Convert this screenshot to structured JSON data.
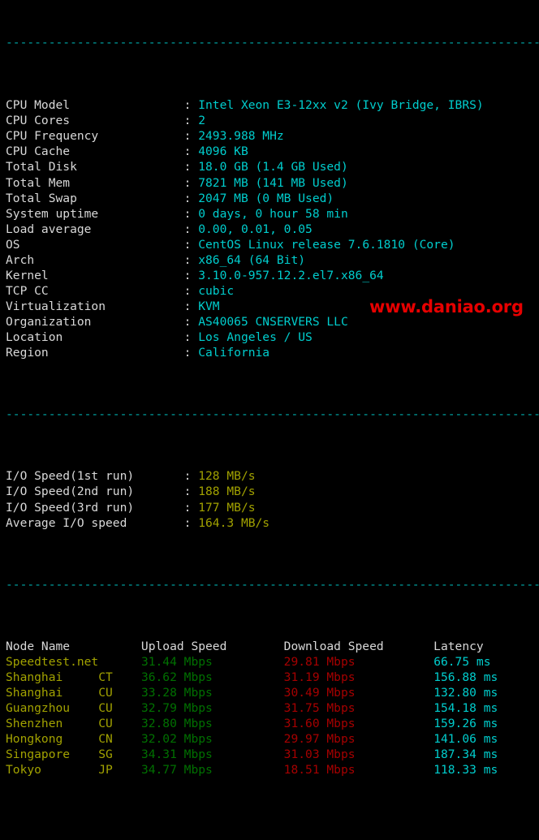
{
  "terminal": {
    "separator_char": "-",
    "separator_repeat": 78,
    "colon": ":",
    "label_width": 25,
    "sysinfo": [
      {
        "label": "CPU Model",
        "value": "Intel Xeon E3-12xx v2 (Ivy Bridge, IBRS)"
      },
      {
        "label": "CPU Cores",
        "value": "2"
      },
      {
        "label": "CPU Frequency",
        "value": "2493.988 MHz"
      },
      {
        "label": "CPU Cache",
        "value": "4096 KB"
      },
      {
        "label": "Total Disk",
        "value": "18.0 GB (1.4 GB Used)"
      },
      {
        "label": "Total Mem",
        "value": "7821 MB (141 MB Used)"
      },
      {
        "label": "Total Swap",
        "value": "2047 MB (0 MB Used)"
      },
      {
        "label": "System uptime",
        "value": "0 days, 0 hour 58 min"
      },
      {
        "label": "Load average",
        "value": "0.00, 0.01, 0.05"
      },
      {
        "label": "OS",
        "value": "CentOS Linux release 7.6.1810 (Core)"
      },
      {
        "label": "Arch",
        "value": "x86_64 (64 Bit)"
      },
      {
        "label": "Kernel",
        "value": "3.10.0-957.12.2.el7.x86_64"
      },
      {
        "label": "TCP CC",
        "value": "cubic"
      },
      {
        "label": "Virtualization",
        "value": "KVM"
      },
      {
        "label": "Organization",
        "value": "AS40065 CNSERVERS LLC"
      },
      {
        "label": "Location",
        "value": "Los Angeles / US"
      },
      {
        "label": "Region",
        "value": "California"
      }
    ],
    "iospeed": [
      {
        "label": "I/O Speed(1st run)",
        "value": "128 MB/s"
      },
      {
        "label": "I/O Speed(2nd run)",
        "value": "188 MB/s"
      },
      {
        "label": "I/O Speed(3rd run)",
        "value": "177 MB/s"
      },
      {
        "label": "Average I/O speed",
        "value": "164.3 MB/s"
      }
    ],
    "speedtest": {
      "headers": {
        "node": "Node Name",
        "upload": "Upload Speed",
        "download": "Download Speed",
        "latency": "Latency"
      },
      "rows": [
        {
          "node": "Speedtest.net",
          "carrier": "",
          "upload": "31.44 Mbps",
          "download": "29.81 Mbps",
          "latency": "66.75 ms"
        },
        {
          "node": "Shanghai",
          "carrier": "CT",
          "upload": "36.62 Mbps",
          "download": "31.19 Mbps",
          "latency": "156.88 ms"
        },
        {
          "node": "Shanghai",
          "carrier": "CU",
          "upload": "33.28 Mbps",
          "download": "30.49 Mbps",
          "latency": "132.80 ms"
        },
        {
          "node": "Guangzhou",
          "carrier": "CU",
          "upload": "32.79 Mbps",
          "download": "31.75 Mbps",
          "latency": "154.18 ms"
        },
        {
          "node": "Shenzhen",
          "carrier": "CU",
          "upload": "32.80 Mbps",
          "download": "31.60 Mbps",
          "latency": "159.26 ms"
        },
        {
          "node": "Hongkong",
          "carrier": "CN",
          "upload": "32.02 Mbps",
          "download": "29.97 Mbps",
          "latency": "141.06 ms"
        },
        {
          "node": "Singapore",
          "carrier": "SG",
          "upload": "34.31 Mbps",
          "download": "31.03 Mbps",
          "latency": "187.34 ms"
        },
        {
          "node": "Tokyo",
          "carrier": "JP",
          "upload": "34.77 Mbps",
          "download": "18.51 Mbps",
          "latency": "118.33 ms"
        }
      ]
    },
    "watermark": "www.daniao.org",
    "colors": {
      "background": "#000000",
      "label": "#d8d8d8",
      "value_cyan": "#00cdcd",
      "value_yellow": "#a2a200",
      "separator": "#00aaaa",
      "node": "#a2a200",
      "upload": "#007000",
      "download": "#a60000",
      "latency": "#00cdcd",
      "watermark": "#e60000"
    }
  }
}
